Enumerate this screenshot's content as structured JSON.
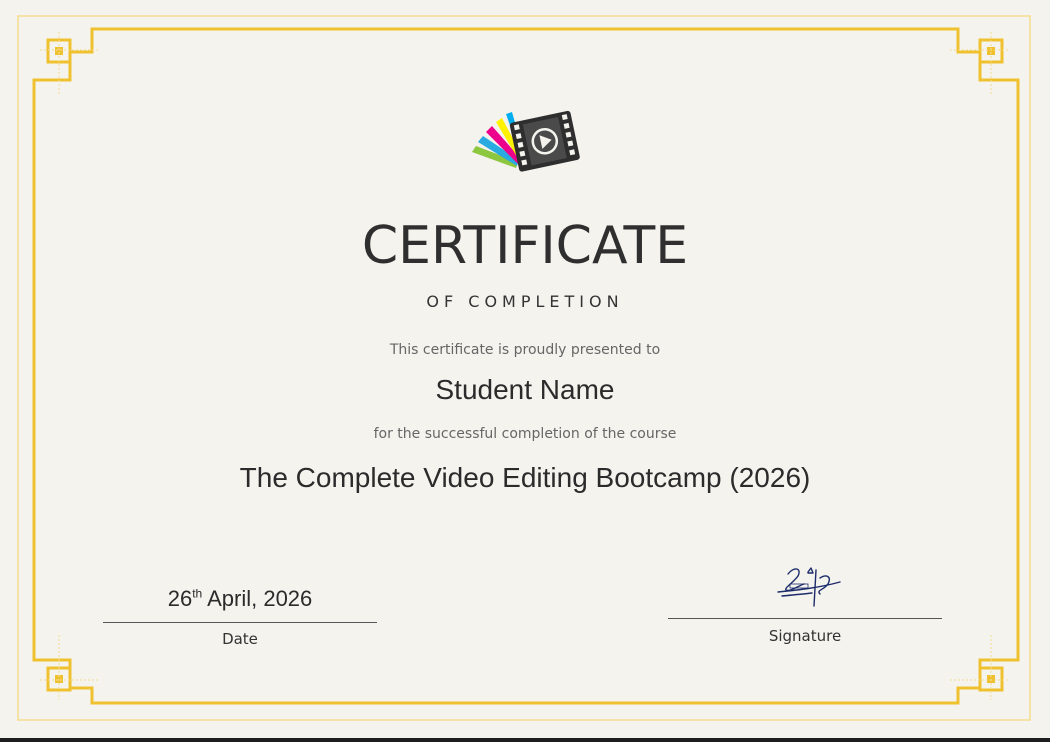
{
  "certificate": {
    "title": "CERTIFICATE",
    "subtitle": "OF COMPLETION",
    "presented_text": "This certificate is proudly presented to",
    "recipient_name": "Student Name",
    "completion_text": "for the successful completion of the course",
    "course_name": "The Complete Video Editing Bootcamp (2026)",
    "date": {
      "day": "26",
      "ordinal": "th",
      "rest": " April, 2026",
      "label": "Date"
    },
    "signature_label": "Signature"
  },
  "colors": {
    "background": "#f4f3ee",
    "border_gold": "#efc12f",
    "border_light": "#f4dc8f",
    "text_dark": "#2f2f2f",
    "text_muted": "#666666"
  },
  "icons": {
    "logo": "film-strip-play-icon",
    "signature": "handwritten-signature"
  }
}
